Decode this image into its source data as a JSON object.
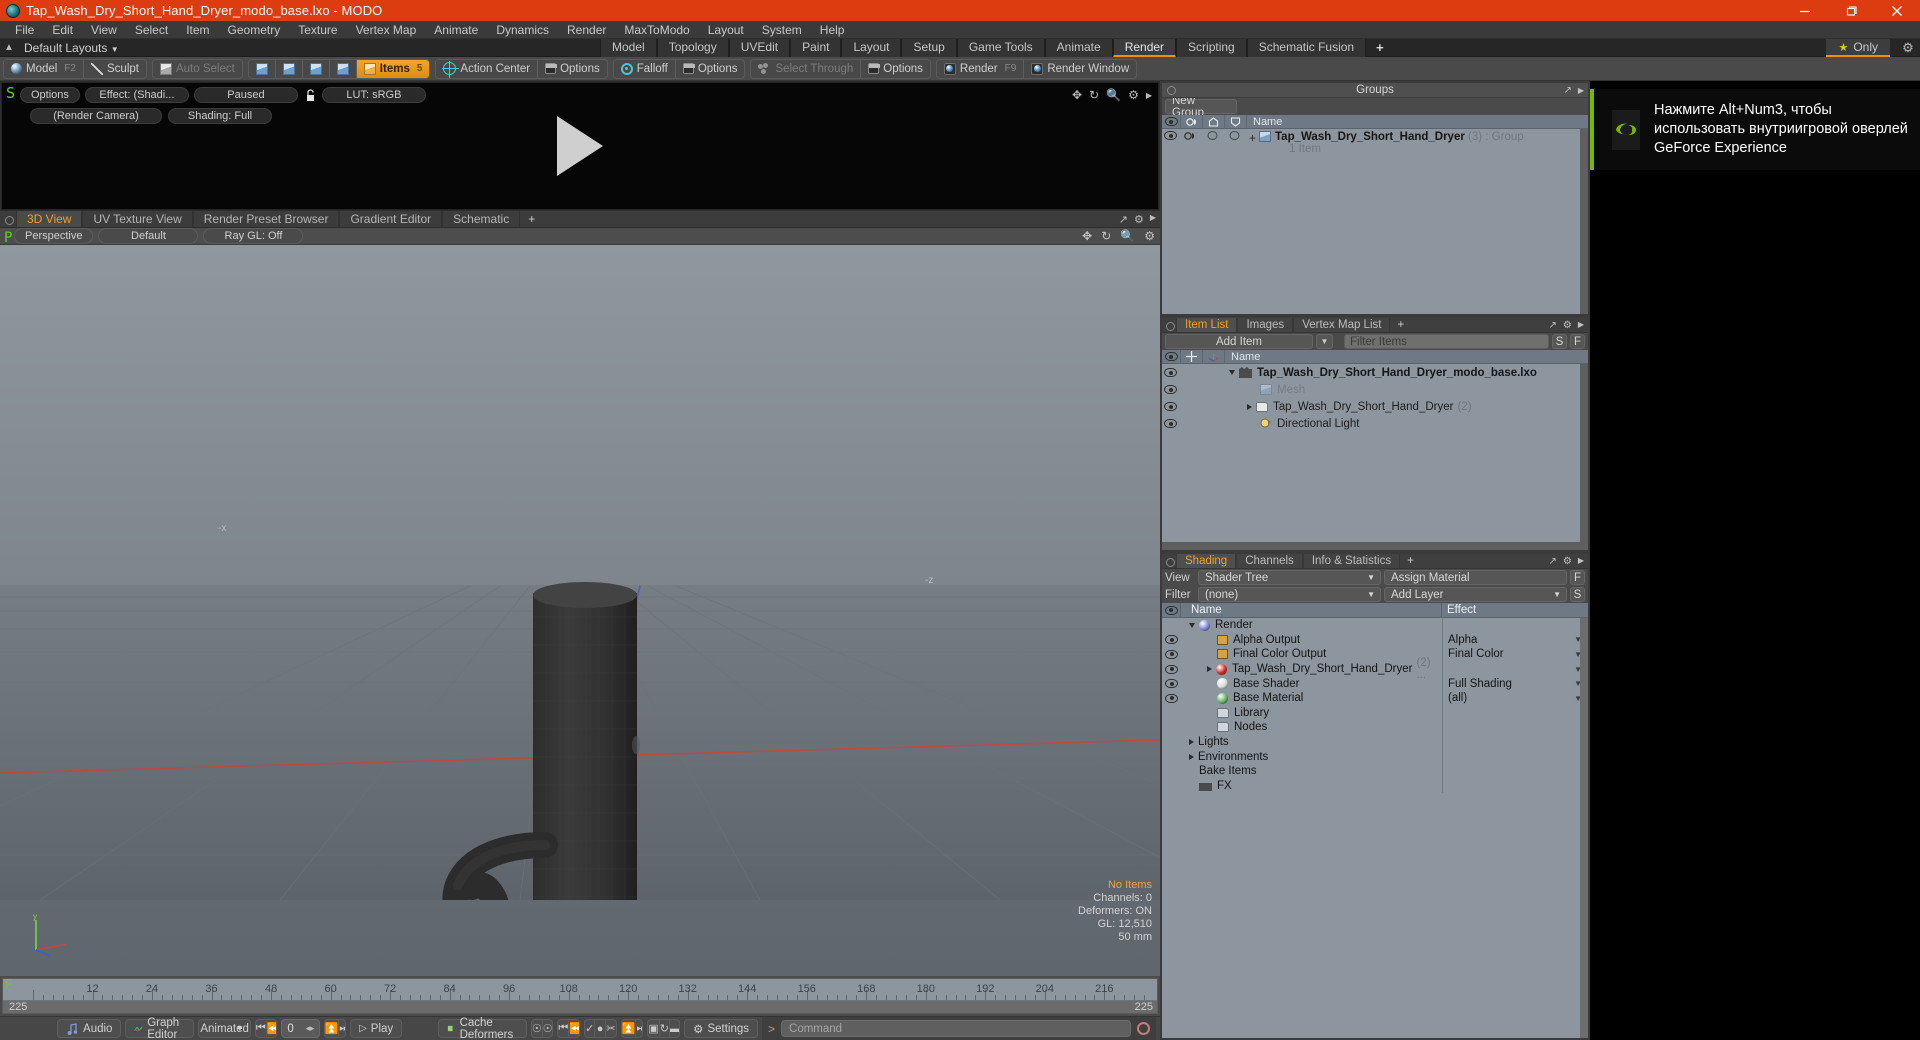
{
  "window": {
    "title": "Tap_Wash_Dry_Short_Hand_Dryer_modo_base.lxo - MODO",
    "minimize": "minimize-icon",
    "maximize": "restore-icon",
    "close": "close-icon"
  },
  "menu": {
    "items": [
      "File",
      "Edit",
      "View",
      "Select",
      "Item",
      "Geometry",
      "Texture",
      "Vertex Map",
      "Animate",
      "Dynamics",
      "Render",
      "MaxToModo",
      "Layout",
      "System",
      "Help"
    ]
  },
  "layout_row": {
    "default_layouts": "Default Layouts",
    "tabs": [
      {
        "label": "Model",
        "active": false
      },
      {
        "label": "Topology",
        "active": false
      },
      {
        "label": "UVEdit",
        "active": false
      },
      {
        "label": "Paint",
        "active": false
      },
      {
        "label": "Layout",
        "active": false
      },
      {
        "label": "Setup",
        "active": false
      },
      {
        "label": "Game Tools",
        "active": false
      },
      {
        "label": "Animate",
        "active": false
      },
      {
        "label": "Render",
        "active": true
      },
      {
        "label": "Scripting",
        "active": false
      },
      {
        "label": "Schematic Fusion",
        "active": false
      }
    ],
    "add_tab": "+",
    "only_label": "Only",
    "gear": "gear-icon"
  },
  "modebar": {
    "model": "Model",
    "model_key": "F2",
    "sculpt": "Sculpt",
    "auto_select": "Auto Select",
    "items": "Items",
    "items_key": "5",
    "action_center": "Action Center",
    "options1": "Options",
    "falloff": "Falloff",
    "options2": "Options",
    "select_through": "Select Through",
    "options3": "Options",
    "render": "Render",
    "render_key": "F9",
    "render_window": "Render Window"
  },
  "preview": {
    "options": "Options",
    "effect": "Effect: (Shadi...",
    "paused": "Paused",
    "lut": "LUT: sRGB",
    "camera": "(Render Camera)",
    "shading": "Shading: Full",
    "corner_mark": "S"
  },
  "viewport_tabs": {
    "tabs": [
      {
        "label": "3D View",
        "active": true
      },
      {
        "label": "UV Texture View",
        "active": false
      },
      {
        "label": "Render Preset Browser",
        "active": false
      },
      {
        "label": "Gradient Editor",
        "active": false
      },
      {
        "label": "Schematic",
        "active": false
      }
    ],
    "add_tab": "+"
  },
  "viewport_tools": {
    "perspective": "Perspective",
    "default": "Default",
    "raygl": "Ray GL: Off",
    "corner_mark": "P"
  },
  "viewport": {
    "stats": {
      "no_items": "No Items",
      "channels": "Channels: 0",
      "deformers": "Deformers: ON",
      "gl": "GL: 12,510",
      "scale": "50 mm"
    },
    "axes": {
      "x": "-x",
      "z": "-z",
      "y": "y"
    }
  },
  "timeline": {
    "ticks": [
      12,
      24,
      36,
      48,
      60,
      72,
      84,
      96,
      108,
      120,
      132,
      144,
      156,
      168,
      180,
      192,
      204,
      216
    ],
    "range_start": "225",
    "range_end": "225",
    "corner_mark": "F"
  },
  "bottombar": {
    "audio": "Audio",
    "graph_editor": "Graph Editor",
    "mode": "Animated",
    "frame_value": "0",
    "play": "Play",
    "cache_deformers": "Cache Deformers",
    "settings": "Settings",
    "command_placeholder": "Command",
    "command_prompt": ">"
  },
  "groups_panel": {
    "title": "Groups",
    "new_group": "New Group",
    "columns": [
      "visible-col",
      "shade-col",
      "lock-col",
      "select-col",
      "Name"
    ],
    "rows": [
      {
        "name": "Tap_Wash_Dry_Short_Hand_Dryer",
        "count": "(3)",
        "type": ": Group",
        "sub": "1 Item"
      }
    ]
  },
  "item_list_panel": {
    "tabs": [
      {
        "label": "Item List",
        "active": true
      },
      {
        "label": "Images",
        "active": false
      },
      {
        "label": "Vertex Map List",
        "active": false
      }
    ],
    "add_tab": "+",
    "add_item": "Add Item",
    "filter_placeholder": "Filter Items",
    "btn_s": "S",
    "btn_f": "F",
    "columns": [
      "visible-col",
      "move-col",
      "transform-col",
      "Name"
    ],
    "rows": [
      {
        "name": "Tap_Wash_Dry_Short_Hand_Dryer_modo_base.lxo",
        "suffix": "",
        "indent": 0,
        "bold": true,
        "dim": false,
        "icon": "scene-icon",
        "expander": "down"
      },
      {
        "name": "Mesh",
        "suffix": "",
        "indent": 1,
        "bold": false,
        "dim": true,
        "icon": "mesh-icon",
        "expander": "none"
      },
      {
        "name": "Tap_Wash_Dry_Short_Hand_Dryer",
        "suffix": "(2)",
        "indent": 1,
        "bold": false,
        "dim": false,
        "icon": "group-icon",
        "expander": "right"
      },
      {
        "name": "Directional Light",
        "suffix": "",
        "indent": 1,
        "bold": false,
        "dim": false,
        "icon": "light-icon",
        "expander": "none"
      }
    ]
  },
  "shading_panel": {
    "tabs": [
      {
        "label": "Shading",
        "active": true
      },
      {
        "label": "Channels",
        "active": false
      },
      {
        "label": "Info & Statistics",
        "active": false
      }
    ],
    "add_tab": "+",
    "view_label": "View",
    "view_value": "Shader Tree",
    "assign_material": "Assign Material",
    "btn_f": "F",
    "filter_label": "Filter",
    "filter_value": "(none)",
    "add_layer": "Add Layer",
    "btn_s": "S",
    "col_name": "Name",
    "col_effect": "Effect",
    "rows": [
      {
        "name": "Render",
        "effect": "",
        "indent": 0,
        "icon": "render-sphere-icon",
        "color": "#7d86d8",
        "expander": "down",
        "eye": false,
        "caret": false
      },
      {
        "name": "Alpha Output",
        "effect": "Alpha",
        "indent": 1,
        "icon": "output-icon",
        "color": "#d8a23c",
        "expander": "none",
        "eye": true,
        "caret": true
      },
      {
        "name": "Final Color Output",
        "effect": "Final Color",
        "indent": 1,
        "icon": "output-icon",
        "color": "#d8a23c",
        "expander": "none",
        "eye": true,
        "caret": true
      },
      {
        "name": "Tap_Wash_Dry_Short_Hand_Dryer",
        "suffix": "(2) ...",
        "effect": "",
        "indent": 1,
        "icon": "material-icon",
        "color": "#cc2b22",
        "expander": "right",
        "eye": true,
        "caret": true
      },
      {
        "name": "Base Shader",
        "effect": "Full Shading",
        "indent": 1,
        "icon": "shader-icon",
        "color": "#d9d9d9",
        "expander": "none",
        "eye": true,
        "caret": true
      },
      {
        "name": "Base Material",
        "effect": "(all)",
        "indent": 1,
        "icon": "material-green-icon",
        "color": "#5fb05f",
        "expander": "none",
        "eye": true,
        "caret": true
      },
      {
        "name": "Library",
        "effect": "",
        "indent": 1,
        "icon": "folder-icon",
        "color": "",
        "expander": "none",
        "eye": false,
        "caret": false
      },
      {
        "name": "Nodes",
        "effect": "",
        "indent": 1,
        "icon": "folder-icon",
        "color": "",
        "expander": "none",
        "eye": false,
        "caret": false
      },
      {
        "name": "Lights",
        "effect": "",
        "indent": 0,
        "icon": "",
        "color": "",
        "expander": "right",
        "eye": false,
        "caret": false
      },
      {
        "name": "Environments",
        "effect": "",
        "indent": 0,
        "icon": "",
        "color": "",
        "expander": "right",
        "eye": false,
        "caret": false
      },
      {
        "name": "Bake Items",
        "effect": "",
        "indent": 0,
        "icon": "",
        "color": "",
        "expander": "none",
        "eye": false,
        "caret": false
      },
      {
        "name": "FX",
        "effect": "",
        "indent": 0,
        "icon": "fx-icon",
        "color": "",
        "expander": "none",
        "eye": false,
        "caret": false
      }
    ]
  },
  "nvidia_toast": {
    "text": "Нажмите Alt+Num3, чтобы использовать внутриигровой оверлей GeForce Experience",
    "accent": "#76b900"
  },
  "colors": {
    "title_bar": "#dd3c10",
    "accent": "#f09000",
    "panel_bg": "#4a4a4a",
    "list_bg": "#8d969e"
  }
}
